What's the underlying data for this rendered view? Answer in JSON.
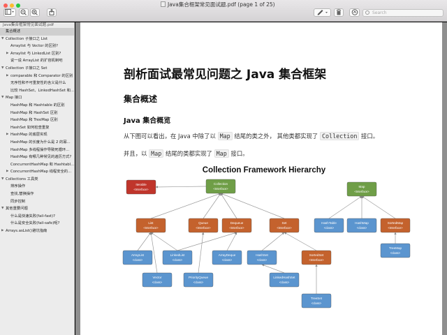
{
  "window": {
    "title": "Java集合框架常见面试题.pdf (page 1 of 25)"
  },
  "toolbar": {
    "search_placeholder": "Search"
  },
  "sidebar": {
    "filename": "Java集合框架常见面试题.pdf",
    "items": [
      {
        "label": "集合概述",
        "level": 0,
        "expanded": false,
        "selected": true
      },
      {
        "label": "Collection 子接口之 List",
        "level": 0,
        "expanded": true
      },
      {
        "label": "Arraylist 与 Vector 的区别?",
        "level": 1
      },
      {
        "label": "Arraylist 与 LinkedList 区别?",
        "level": 1,
        "collapsed": true
      },
      {
        "label": "说一说 ArrayList 的扩容机制吧",
        "level": 1
      },
      {
        "label": "Collection 子接口之 Set",
        "level": 0,
        "expanded": true
      },
      {
        "label": "comparable 和 Comparator 的区别",
        "level": 1,
        "collapsed": true
      },
      {
        "label": "无序性和不可重复性的含义是什么",
        "level": 1
      },
      {
        "label": "比较 HashSet、LinkedHashSet 和...",
        "level": 1
      },
      {
        "label": "Map 接口",
        "level": 0,
        "expanded": true
      },
      {
        "label": "HashMap 和 Hashtable 的区别",
        "level": 1
      },
      {
        "label": "HashMap 和 HashSet 区别",
        "level": 1
      },
      {
        "label": "HashMap 和 TreeMap 区别",
        "level": 1
      },
      {
        "label": "HashSet 如何检查重复",
        "level": 1
      },
      {
        "label": "HashMap 的底层实现",
        "level": 1,
        "collapsed": true
      },
      {
        "label": "HashMap 的长度为什么是 2 的幂...",
        "level": 1
      },
      {
        "label": "HashMap 多线程操作导致死循环...",
        "level": 1
      },
      {
        "label": "HashMap 有哪几种常见的遍历方式?",
        "level": 1
      },
      {
        "label": "ConcurrentHashMap 和 Hashtabl...",
        "level": 1
      },
      {
        "label": "ConcurrentHashMap 线程安全的...",
        "level": 1,
        "collapsed": true
      },
      {
        "label": "Collections 工具类",
        "level": 0,
        "expanded": true
      },
      {
        "label": "排序操作",
        "level": 1
      },
      {
        "label": "查找,替换操作",
        "level": 1
      },
      {
        "label": "同步控制",
        "level": 1
      },
      {
        "label": "其他重要问题",
        "level": 0,
        "expanded": true
      },
      {
        "label": "什么是快速失败(fail-fast)?",
        "level": 1
      },
      {
        "label": "什么是安全失败(fail-safe)呢?",
        "level": 1
      },
      {
        "label": "Arrays.asList()避坑指南",
        "level": 0,
        "collapsed": true
      }
    ]
  },
  "page": {
    "heading": "剖析面试最常见问题之 Java 集合框架",
    "section": "集合概述",
    "subsection": "Java 集合概览",
    "para1": [
      {
        "t": "从下图可以看出，在 Java 中除了以 "
      },
      {
        "t": "Map",
        "code": true
      },
      {
        "t": " 结尾的类之外， 其他类都实现了 "
      },
      {
        "t": "Collection",
        "code": true
      },
      {
        "t": " 接口。"
      }
    ],
    "para2": [
      {
        "t": "并且，以 "
      },
      {
        "t": "Map",
        "code": true
      },
      {
        "t": " 结尾的类都实现了 "
      },
      {
        "t": "Map",
        "code": true
      },
      {
        "t": " 接口。"
      }
    ]
  },
  "diagram": {
    "title": "Collection Framework Hierarchy",
    "colors": {
      "green": "#6f9e47",
      "orange": "#c4622d",
      "blue": "#5b95cf",
      "red": "#c0352b"
    },
    "nodes": {
      "iterable": {
        "name": "Iterable",
        "type": "<Interface>",
        "color": "red"
      },
      "collection": {
        "name": "Collection",
        "type": "<Interface>",
        "color": "green"
      },
      "list": {
        "name": "List",
        "type": "<Interface>",
        "color": "orange"
      },
      "queue": {
        "name": "Queue",
        "type": "<Interface>",
        "color": "orange"
      },
      "dequeue": {
        "name": "Dequeue",
        "type": "<Interface>",
        "color": "orange"
      },
      "set": {
        "name": "Set",
        "type": "<Interface>",
        "color": "orange"
      },
      "arraylist": {
        "name": "ArrayList",
        "type": "<class>",
        "color": "blue"
      },
      "linkedlist": {
        "name": "LinkedList",
        "type": "<class>",
        "color": "blue"
      },
      "arraydeque": {
        "name": "ArrayDeque",
        "type": "<class>",
        "color": "blue"
      },
      "hashset": {
        "name": "HashSet",
        "type": "<class>",
        "color": "blue"
      },
      "sortedset": {
        "name": "SortedSet",
        "type": "<Interface>",
        "color": "orange"
      },
      "vector": {
        "name": "Vector",
        "type": "<class>",
        "color": "blue"
      },
      "priorityqueue": {
        "name": "PriorityQueue",
        "type": "<class>",
        "color": "blue"
      },
      "linkedhashset": {
        "name": "LinkedHashSet",
        "type": "<class>",
        "color": "blue"
      },
      "treeset": {
        "name": "TreeSet",
        "type": "<class>",
        "color": "blue"
      },
      "map": {
        "name": "Map",
        "type": "<Interface>",
        "color": "green"
      },
      "hashtable": {
        "name": "HashTable",
        "type": "<class>",
        "color": "blue"
      },
      "hashmap": {
        "name": "HashMap",
        "type": "<class>",
        "color": "blue"
      },
      "sortedmap": {
        "name": "SortedMap",
        "type": "<Interface>",
        "color": "orange"
      },
      "treemap": {
        "name": "TreeMap",
        "type": "<class>",
        "color": "blue"
      }
    },
    "edges": [
      [
        "collection",
        "iterable"
      ],
      [
        "list",
        "collection"
      ],
      [
        "queue",
        "collection"
      ],
      [
        "dequeue",
        "collection"
      ],
      [
        "set",
        "collection"
      ],
      [
        "arraylist",
        "list"
      ],
      [
        "linkedlist",
        "list"
      ],
      [
        "vector",
        "list"
      ],
      [
        "linkedlist",
        "dequeue"
      ],
      [
        "priorityqueue",
        "queue"
      ],
      [
        "arraydeque",
        "dequeue"
      ],
      [
        "hashset",
        "set"
      ],
      [
        "sortedset",
        "set"
      ],
      [
        "linkedhashset",
        "hashset"
      ],
      [
        "treeset",
        "sortedset"
      ],
      [
        "hashtable",
        "map"
      ],
      [
        "hashmap",
        "map"
      ],
      [
        "sortedmap",
        "map"
      ],
      [
        "treemap",
        "sortedmap"
      ]
    ]
  }
}
